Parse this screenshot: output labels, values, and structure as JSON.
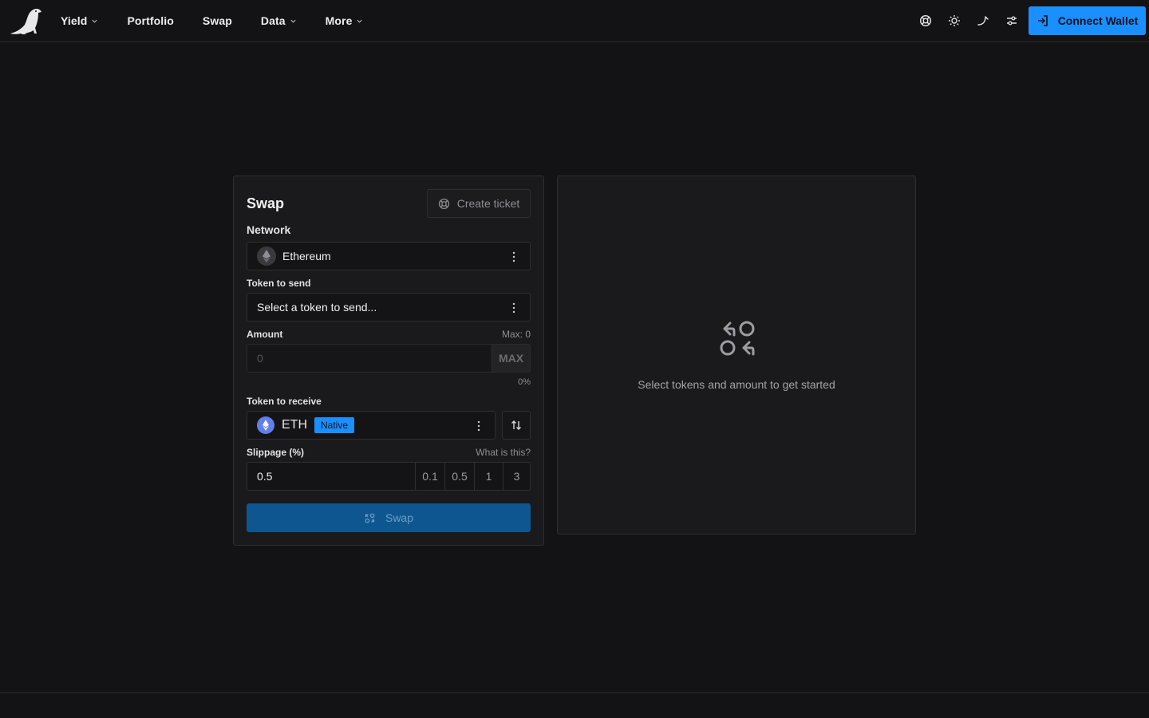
{
  "nav": {
    "items": [
      {
        "label": "Yield",
        "has_dropdown": true
      },
      {
        "label": "Portfolio",
        "has_dropdown": false
      },
      {
        "label": "Swap",
        "has_dropdown": false
      },
      {
        "label": "Data",
        "has_dropdown": true
      },
      {
        "label": "More",
        "has_dropdown": true
      }
    ]
  },
  "header": {
    "icons": [
      "support-icon",
      "sun-icon",
      "curve-icon",
      "settings-sliders-icon"
    ],
    "connect_label": "Connect Wallet",
    "accent": "#1a8fff"
  },
  "swap_card": {
    "title": "Swap",
    "create_ticket_label": "Create ticket",
    "network_label": "Network",
    "network_value": "Ethereum",
    "token_send_label": "Token to send",
    "token_send_placeholder": "Select a token to send...",
    "amount_label": "Amount",
    "amount_max_text": "Max: 0",
    "amount_placeholder": "0",
    "max_button_label": "MAX",
    "percent_text": "0%",
    "token_receive_label": "Token to receive",
    "token_receive_value": "ETH",
    "token_receive_badge": "Native",
    "slippage_label": "Slippage (%)",
    "slippage_help": "What is this?",
    "slippage_value": "0.5",
    "slippage_options": [
      "0.1",
      "0.5",
      "1",
      "3"
    ],
    "swap_button_label": "Swap"
  },
  "panel": {
    "message": "Select tokens and amount to get started",
    "icon": "swap-arrows-icon"
  }
}
